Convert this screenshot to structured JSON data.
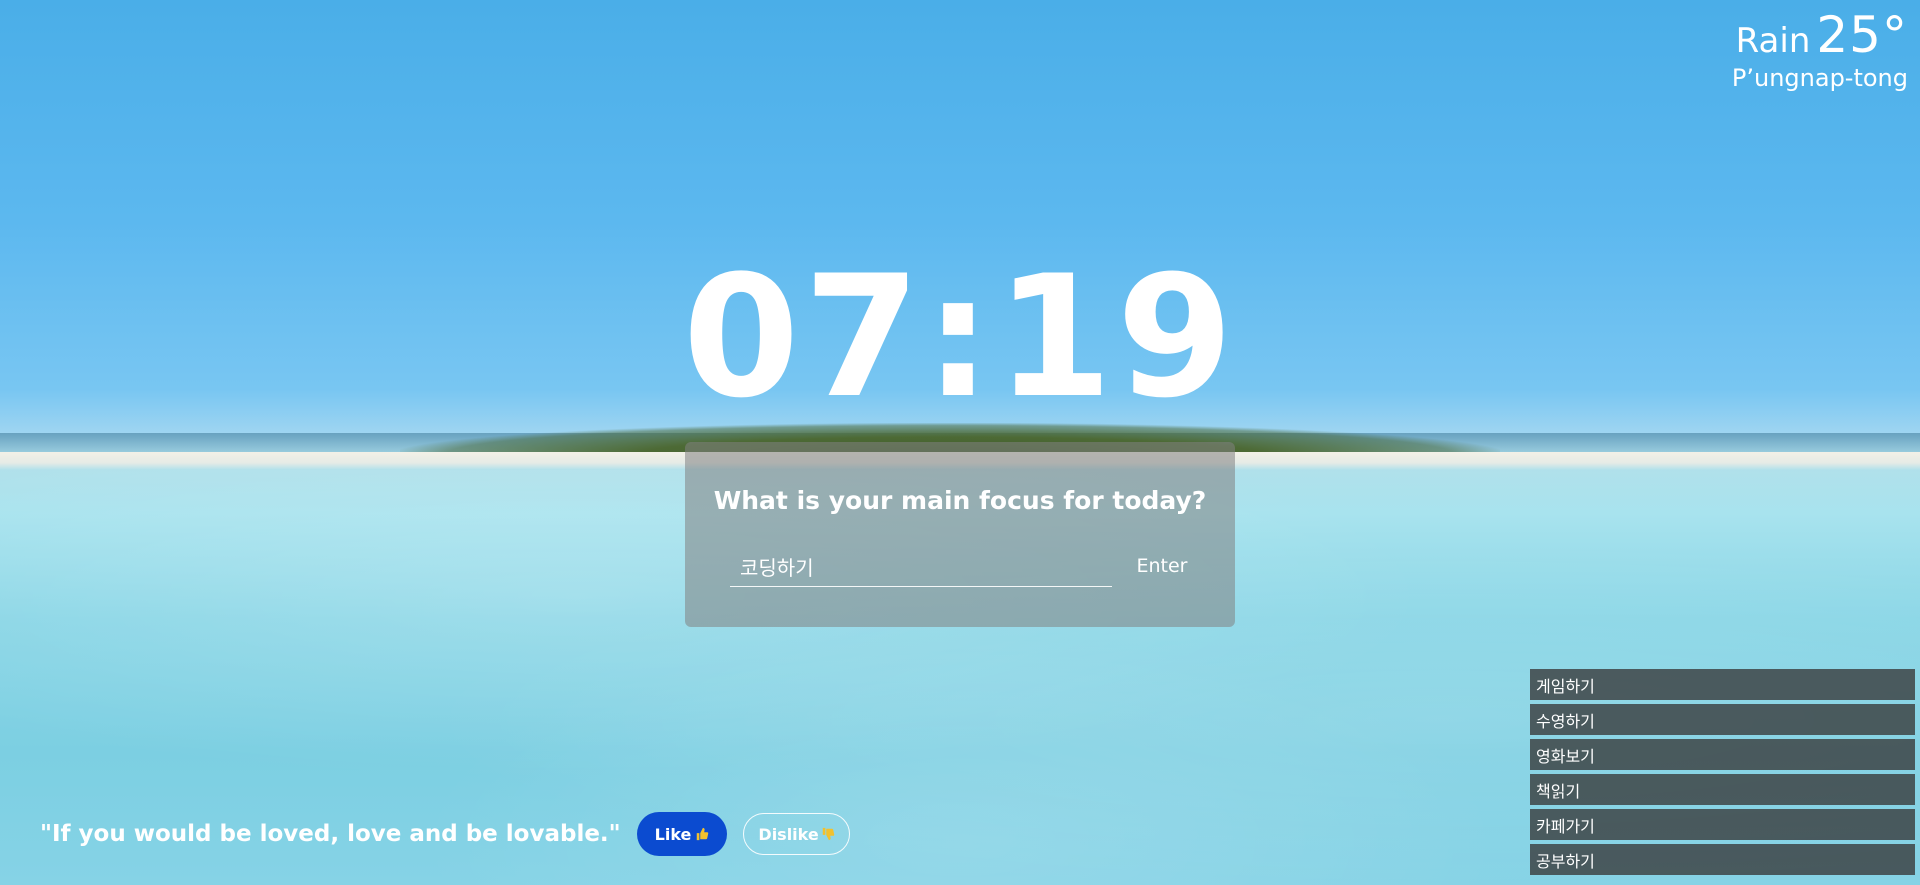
{
  "weather": {
    "condition": "Rain",
    "temperature": "25°",
    "city": "P’ungnap-tong"
  },
  "clock": {
    "time": "07:19"
  },
  "focus": {
    "question": "What is your main focus for today?",
    "input_value": "코딩하기",
    "enter_label": "Enter"
  },
  "quote": {
    "text": "\"If you would be loved, love and be lovable.\"",
    "like_label": "Like",
    "dislike_label": "Dislike"
  },
  "todos": [
    {
      "label": "게임하기"
    },
    {
      "label": "수영하기"
    },
    {
      "label": "영화보기"
    },
    {
      "label": "책읽기"
    },
    {
      "label": "카페가기"
    },
    {
      "label": "공부하기"
    }
  ],
  "colors": {
    "like_button": "#0b4bd0",
    "panel": "rgba(130,130,130,0.55)",
    "todo_bg": "rgba(55,55,55,0.78)",
    "thumb": "#f2c12e"
  },
  "icons": {
    "like": "thumbs-up-icon",
    "dislike": "thumbs-down-icon"
  }
}
